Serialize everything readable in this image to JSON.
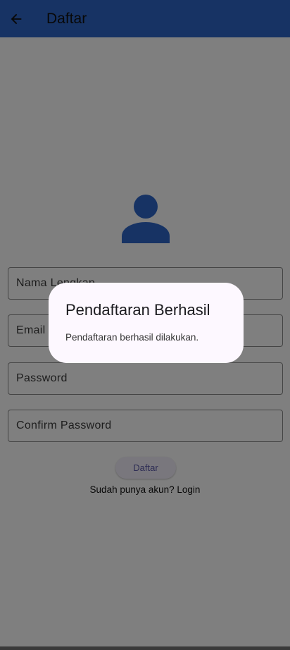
{
  "app_bar": {
    "title": "Daftar",
    "background": "#2f67c8",
    "back_icon": "arrow-left-icon"
  },
  "form": {
    "avatar_icon": "person-icon",
    "avatar_color": "#2f67c8",
    "fields": {
      "name": "Nama Lengkap",
      "email": "Email",
      "password": "Password",
      "confirm_password": "Confirm Password"
    },
    "submit_label": "Daftar",
    "login_prompt": "Sudah punya akun? Login"
  },
  "dialog": {
    "title": "Pendaftaran Berhasil",
    "message": "Pendaftaran berhasil dilakukan."
  }
}
